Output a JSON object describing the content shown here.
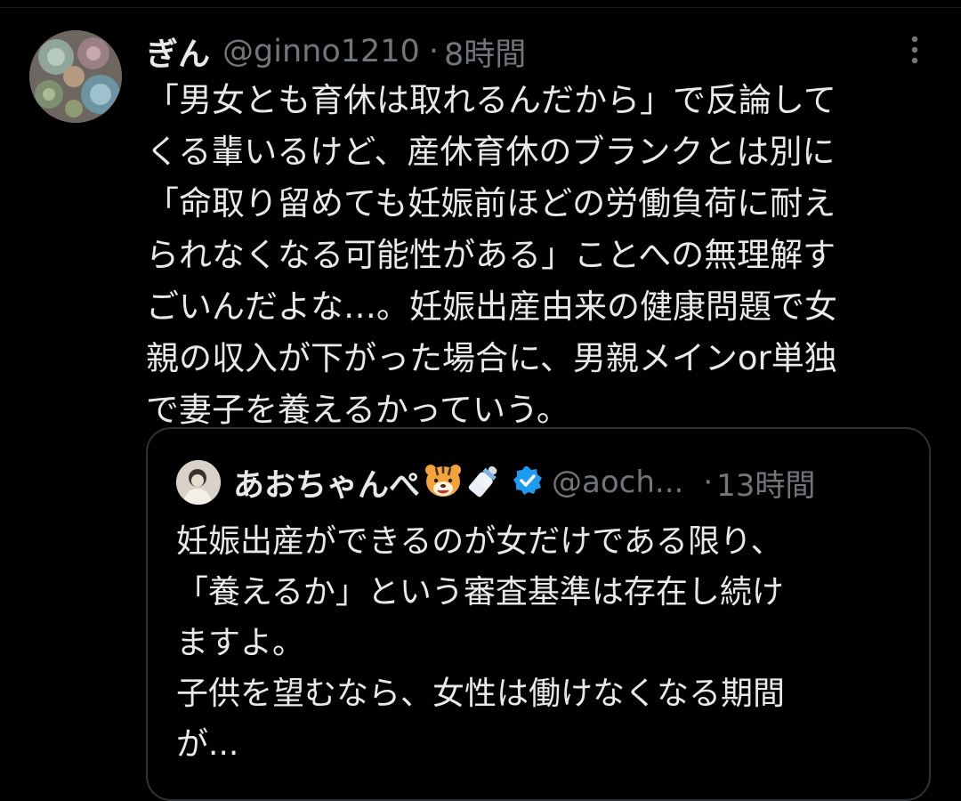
{
  "tweet": {
    "display_name": "ぎん",
    "handle": "@ginno1210",
    "separator": "·",
    "time": "8時間",
    "avatar_icon": "succulent-avatar-icon",
    "more_icon": "more-vertical-icon",
    "lines": [
      "「男女とも育休は取れるんだから」で反論して",
      "くる輩いるけど、産休育休のブランクとは別に",
      "「命取り留めても妊娠前ほどの労働負荷に耐え",
      "られなくなる可能性がある」ことへの無理解す",
      "ごいんだよな…。妊娠出産由来の健康問題で女",
      "親の収入が下がった場合に、男親メインor単独",
      "で妻子を養えるかっていう。"
    ]
  },
  "quote": {
    "display_name": "あおちゃんぺ",
    "emojis": [
      "tiger-face-icon",
      "baby-bottle-icon"
    ],
    "verified_icon": "verified-badge-icon",
    "handle": "@aoch...",
    "separator": "·",
    "time": "13時間",
    "lines": [
      "妊娠出産ができるのが女だけである限り、",
      "「養えるか」という審査基準は存在し続け",
      "ますよ。",
      "子供を望むなら、女性は働けなくなる期間",
      "が..."
    ]
  },
  "colors": {
    "background": "#000000",
    "text": "#e7e9ea",
    "secondary_text": "#71767b",
    "border": "#2f3336",
    "verified": "#1d9bf0"
  }
}
